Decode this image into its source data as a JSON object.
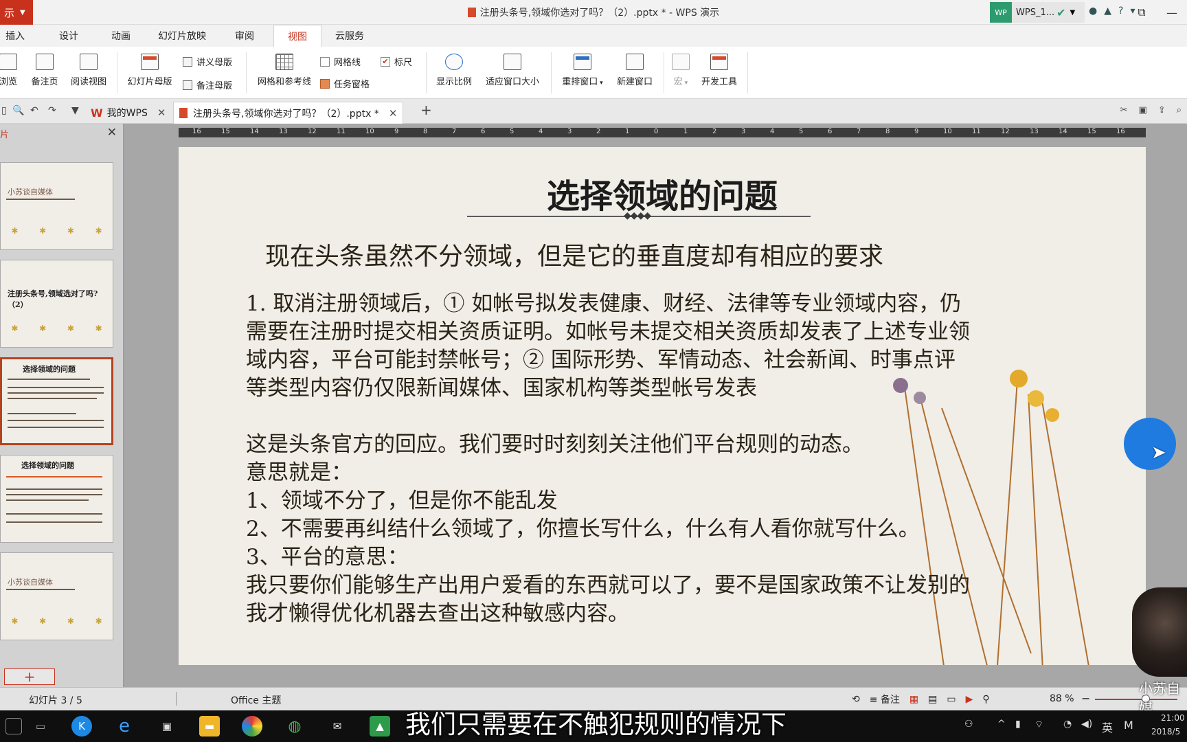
{
  "titlebar": {
    "app_badge": "示",
    "doc_title": "注册头条号,领域你选对了吗？（2）.pptx * - WPS 演示",
    "account_logo": "WP",
    "account_name": "WPS_1...",
    "icons": [
      "theme-icon",
      "skin-icon",
      "help-icon",
      "menu-icon"
    ]
  },
  "menu": {
    "tabs": [
      "插入",
      "设计",
      "动画",
      "幻灯片放映",
      "审阅",
      "视图",
      "云服务"
    ],
    "active": "视图"
  },
  "ribbon": {
    "browse": "浏览",
    "notes_page": "备注页",
    "reading_view": "阅读视图",
    "slide_master": "幻灯片母版",
    "handout_master": "讲义母版",
    "notes_master": "备注母版",
    "grid_guides": "网格和参考线",
    "gridlines": "网格线",
    "ruler": "标尺",
    "task_pane": "任务窗格",
    "zoom": "显示比例",
    "fit_window": "适应窗口大小",
    "arrange": "重排窗口",
    "new_window": "新建窗口",
    "macro": "宏",
    "dev_tools": "开发工具"
  },
  "tabs": {
    "home": "我的WPS",
    "doc": "注册头条号,领域你选对了吗？（2）.pptx *"
  },
  "panel": {
    "header": "片",
    "thumb_title": "小苏谈自媒体",
    "thumb2_title": "注册头条号,领域选对了吗?（2）",
    "thumb3_title": "选择领域的问题",
    "thumb4_title": "选择领域的问题"
  },
  "ruler_labels": [
    "16",
    "15",
    "14",
    "13",
    "12",
    "11",
    "10",
    "9",
    "8",
    "7",
    "6",
    "5",
    "4",
    "3",
    "2",
    "1",
    "0",
    "1",
    "2",
    "3",
    "4",
    "5",
    "6",
    "7",
    "8",
    "9",
    "10",
    "11",
    "12",
    "13",
    "14",
    "15",
    "16"
  ],
  "slide": {
    "title": "选择领域的问题",
    "subtitle": "现在头条虽然不分领域，但是它的垂直度却有相应的要求",
    "para1": [
      "1. 取消注册领域后，① 如帐号拟发表健康、财经、法律等专业领域内容，仍",
      "需要在注册时提交相关资质证明。如帐号未提交相关资质却发表了上述专业领",
      "域内容，平台可能封禁帐号；② 国际形势、军情动态、社会新闻、时事点评",
      "等类型内容仍仅限新闻媒体、国家机构等类型帐号发表"
    ],
    "para2": [
      "这是头条官方的回应。我们要时时刻刻关注他们平台规则的动态。",
      "意思就是：",
      "1、领域不分了，但是你不能乱发",
      "2、不需要再纠结什么领域了，你擅长写什么，什么有人看你就写什么。",
      "3、平台的意思：",
      "我只要你们能够生产出用户爱看的东西就可以了，要不是国家政策不让发别的",
      "我才懒得优化机器去查出这种敏感内容。"
    ]
  },
  "status": {
    "slide_counter": "幻灯片 3 / 5",
    "theme": "Office 主题",
    "notes": "备注",
    "zoom": "88 %"
  },
  "caption": "我们只需要在不触犯规则的情况下",
  "webcam_label": "小苏自媒",
  "taskbar": {
    "time": "21:00",
    "date": "2018/5",
    "ime": "英",
    "m": "M"
  },
  "colors": {
    "accent": "#c8321d",
    "slide_bg": "#f1ede7",
    "cursor_blue": "#1f7be0"
  }
}
